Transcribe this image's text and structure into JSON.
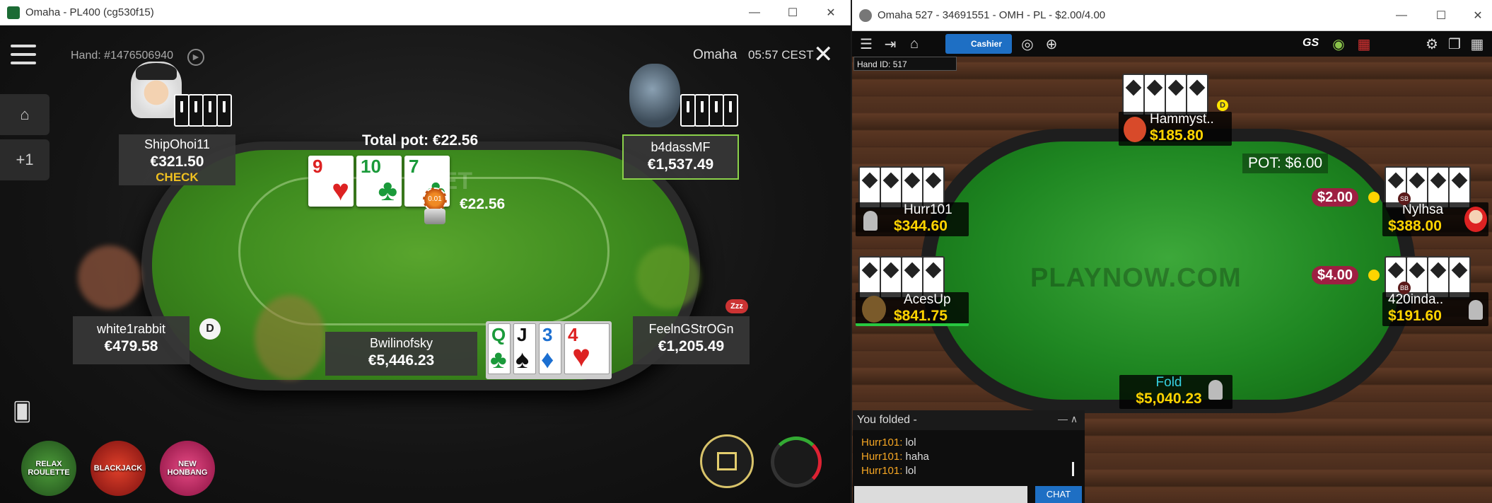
{
  "left_window": {
    "title": "Omaha - PL400 (cg530f15)",
    "hand_label": "Hand: #1476506940",
    "game_name": "Omaha",
    "clock": "05:57 CEST",
    "side_plus": "+1",
    "total_pot": "Total pot: €22.56",
    "pot_chips": "€22.56",
    "small_chip": "0.01",
    "watermark": "BET",
    "board": [
      {
        "rank": "9",
        "suit": "♥",
        "color": "#d22"
      },
      {
        "rank": "10",
        "suit": "♣",
        "color": "#1a9a3a"
      },
      {
        "rank": "7",
        "suit": "♣",
        "color": "#1a9a3a"
      }
    ],
    "players": {
      "top_left": {
        "name": "ShipOhoi11",
        "stack": "€321.50",
        "action": "CHECK"
      },
      "top_right": {
        "name": "b4dassMF",
        "stack": "€1,537.49"
      },
      "left": {
        "name": "white1rabbit",
        "stack": "€479.58",
        "dealer": "D"
      },
      "bottom": {
        "name": "Bwilinofsky",
        "stack": "€5,446.23"
      },
      "right": {
        "name": "FeelnGStrOGn",
        "stack": "€1,205.49",
        "zzz": "Zzz"
      }
    },
    "hero_cards": [
      {
        "rank": "Q",
        "suit": "♣",
        "color": "#1a9a3a"
      },
      {
        "rank": "J",
        "suit": "♠",
        "color": "#111"
      },
      {
        "rank": "3",
        "suit": "♦",
        "color": "#1c6fd1"
      },
      {
        "rank": "4",
        "suit": "♥",
        "color": "#d22"
      }
    ],
    "games": [
      {
        "label": "RELAX ROULETTE",
        "color": "#2d6a2b"
      },
      {
        "label": "BLACKJACK",
        "color": "#b81c1c"
      },
      {
        "label": "NEW HONBANG",
        "color": "#c2185b"
      }
    ],
    "icons": [
      "menu-icon",
      "home-icon",
      "replay-icon",
      "close-icon",
      "gift-icon",
      "timer-icon",
      "cards-icon"
    ]
  },
  "right_window": {
    "title": "Omaha 527 - 34691551 - OMH - PL - $2.00/4.00",
    "cashier": "Cashier",
    "toolbar_gs": "GS",
    "hand_id": "Hand ID: 517",
    "pot": "POT: $6.00",
    "watermark": "PLAYNOW.COM",
    "players": {
      "top": {
        "name": "Hammyst..",
        "stack": "$185.80",
        "dealer": "D"
      },
      "left_top": {
        "name": "Hurr101",
        "stack": "$344.60"
      },
      "left_bottom": {
        "name": "AcesUp",
        "stack": "$841.75"
      },
      "right_top": {
        "name": "Nylhsa",
        "stack": "$388.00",
        "blind": "SB",
        "bet": "$2.00"
      },
      "right_bottom": {
        "name": "420inda..",
        "stack": "$191.60",
        "blind": "BB",
        "bet": "$4.00"
      },
      "hero": {
        "action": "Fold",
        "stack": "$5,040.23"
      }
    },
    "chat": {
      "header": "You folded -",
      "lines": [
        {
          "who": "Hurr101:",
          "msg": " lol"
        },
        {
          "who": "Hurr101:",
          "msg": " haha"
        },
        {
          "who": "Hurr101:",
          "msg": " lol"
        }
      ],
      "send": "CHAT"
    }
  }
}
